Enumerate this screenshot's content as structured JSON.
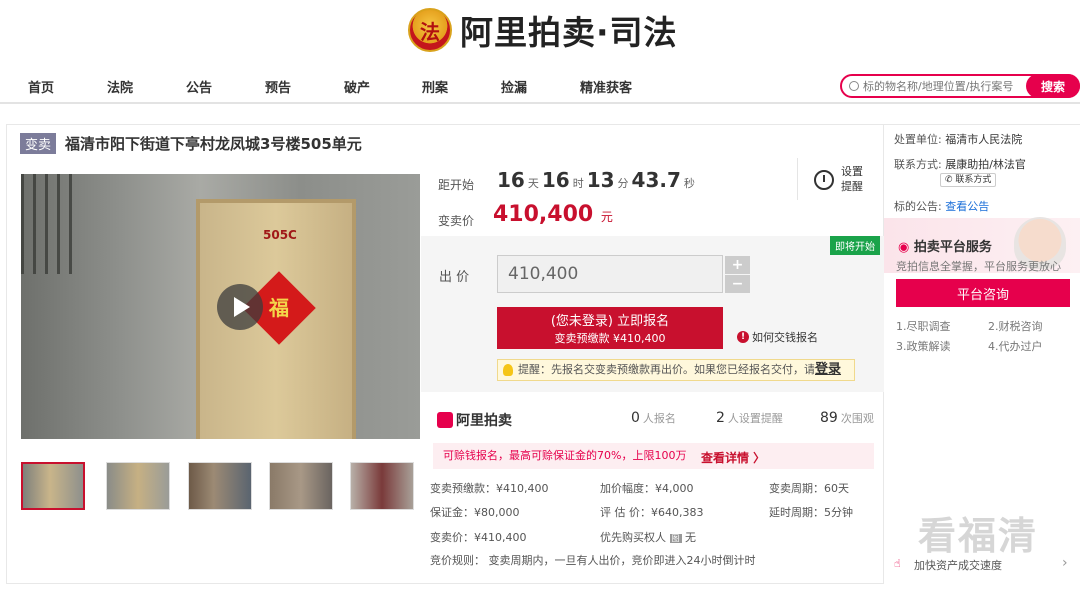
{
  "header": {
    "logo_text": "阿里拍卖·司法",
    "emblem_glyph": "法"
  },
  "nav": {
    "items": [
      "首页",
      "法院",
      "公告",
      "预告",
      "破产",
      "刑案",
      "捡漏",
      "精准获客"
    ]
  },
  "search": {
    "placeholder": "标的物名称/地理位置/执行案号",
    "button": "搜索"
  },
  "listing": {
    "badge": "变卖",
    "title": "福清市阳下街道下亭村龙凤城3号楼505单元",
    "door_number": "505C",
    "fu_char": "福"
  },
  "countdown": {
    "label": "距开始",
    "days": "16",
    "days_unit": "天",
    "hours": "16",
    "hours_unit": "时",
    "minutes": "13",
    "minutes_unit": "分",
    "seconds": "43.7",
    "seconds_unit": "秒"
  },
  "remind": {
    "label": "设置提醒"
  },
  "price": {
    "label": "变卖价",
    "value": "410,400",
    "unit": "元"
  },
  "bid": {
    "tag": "即将开始",
    "label": "出 价",
    "value": "410,400",
    "plus": "+",
    "minus": "−",
    "signup_line1": "(您未登录) 立即报名",
    "signup_line2": "变卖预缴款 ¥410,400",
    "howto": "如何交钱报名",
    "howto_icon": "!",
    "tip_text": "提醒：先报名交变卖预缴款再出价。如果您已经报名交付，请",
    "tip_link": "登录"
  },
  "stats": {
    "brand": "阿里拍卖",
    "signups": "0",
    "signups_label": "人报名",
    "reminders": "2",
    "reminders_label": "人设置提醒",
    "views": "89",
    "views_label": "次围观"
  },
  "loan": {
    "text": "可赊钱报名，最高可赊保证金的70%，上限100万",
    "link": "查看详情 〉"
  },
  "details": {
    "deposit": "变卖预缴款：¥410,400",
    "increment": "加价幅度：¥4,000",
    "period": "变卖周期：60天",
    "bond": "保证金：¥80,000",
    "valuation": "评 估 价：¥640,383",
    "delay": "延时周期：5分钟",
    "sale_price": "变卖价：¥410,400",
    "priority": "优先购买权人",
    "priority_badge": "图",
    "priority_value": "无",
    "rule": "竞价规则：  变卖周期内，一旦有人出价，竞价即进入24小时倒计时"
  },
  "sidebar": {
    "court_label": "处置单位:",
    "court": "福清市人民法院",
    "contact_label": "联系方式:",
    "contact": "展康助拍/林法官",
    "contact_btn": "联系方式",
    "notice_label": "标的公告:",
    "notice_link": "查看公告",
    "service_title": "拍卖平台服务",
    "service_sub": "竞拍信息全掌握，平台服务更放心",
    "consult": "平台咨询",
    "items": [
      "1.尽职调查",
      "2.财税咨询",
      "3.政策解读",
      "4.代办过户"
    ],
    "bottom": "加快资产成交速度"
  },
  "watermark": "看福清",
  "colors": {
    "brand": "#e6004c",
    "price": "#c8102e",
    "tag": "#1aa34a"
  }
}
